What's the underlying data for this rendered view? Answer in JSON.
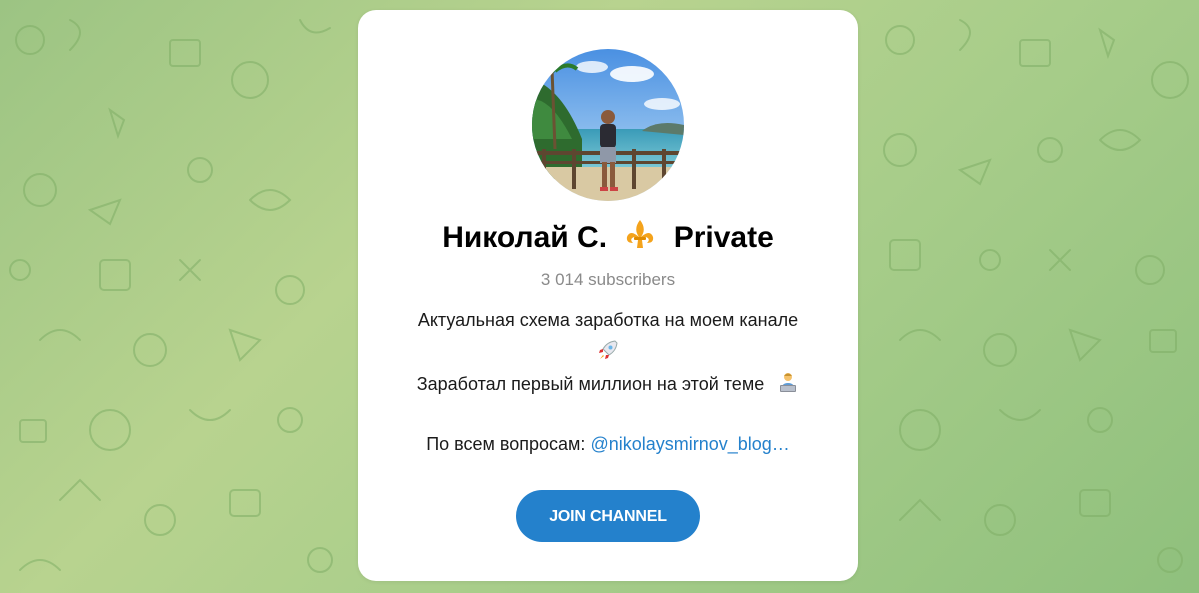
{
  "channel": {
    "name": "Николай С.",
    "badge_icon": "fleur-de-lis-icon",
    "tag": "Private",
    "subscribers": "3 014 subscribers"
  },
  "description": {
    "line1": "Актуальная схема заработка на моем канале",
    "line1_icon": "rocket-icon",
    "line2": "Заработал первый миллион на этой теме",
    "line2_icon": "technologist-icon",
    "contact_label": "По всем вопросам:",
    "contact_link": "@nikolaysmirnov_blog…"
  },
  "actions": {
    "join_label": "JOIN CHANNEL"
  },
  "colors": {
    "accent": "#2481cc",
    "background": "#a8cd8a",
    "card": "#ffffff",
    "subtitle": "#8a8a8a"
  }
}
